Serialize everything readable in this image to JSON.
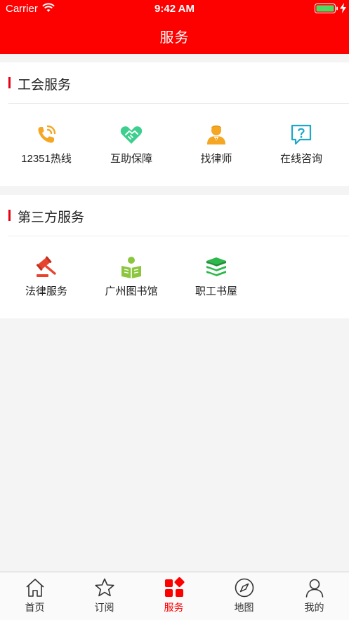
{
  "status_bar": {
    "carrier": "Carrier",
    "time": "9:42 AM"
  },
  "nav": {
    "title": "服务"
  },
  "colors": {
    "brand": "#fd0000",
    "accent_bar": "#e60012"
  },
  "sections": [
    {
      "title": "工会服务",
      "items": [
        {
          "label": "12351热线",
          "icon": "phone-icon",
          "color": "#f5a623"
        },
        {
          "label": "互助保障",
          "icon": "handshake-icon",
          "color": "#3ecf8e"
        },
        {
          "label": "找律师",
          "icon": "lawyer-icon",
          "color": "#f5a623"
        },
        {
          "label": "在线咨询",
          "icon": "question-chat-icon",
          "color": "#1ea7c9"
        }
      ]
    },
    {
      "title": "第三方服务",
      "items": [
        {
          "label": "法律服务",
          "icon": "gavel-icon",
          "color": "#e8432e"
        },
        {
          "label": "广州图书馆",
          "icon": "reader-icon",
          "color": "#8cc63f"
        },
        {
          "label": "职工书屋",
          "icon": "books-icon",
          "color": "#2db84b"
        }
      ]
    }
  ],
  "tabbar": {
    "tabs": [
      {
        "label": "首页",
        "icon": "home-icon"
      },
      {
        "label": "订阅",
        "icon": "star-icon"
      },
      {
        "label": "服务",
        "icon": "grid-icon",
        "active": true
      },
      {
        "label": "地图",
        "icon": "compass-icon"
      },
      {
        "label": "我的",
        "icon": "user-icon"
      }
    ]
  }
}
